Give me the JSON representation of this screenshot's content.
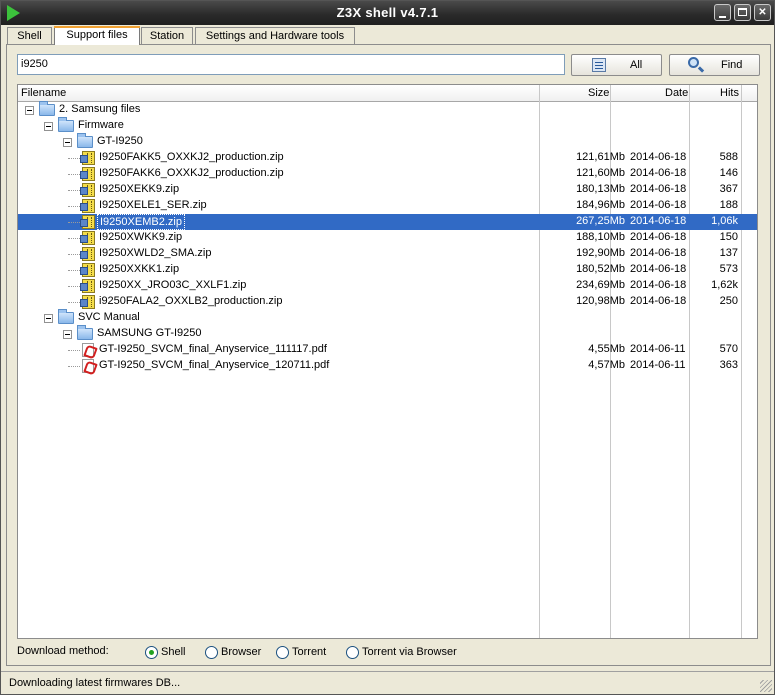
{
  "window": {
    "title": "Z3X shell v4.7.1"
  },
  "tabs": [
    {
      "label": "Shell",
      "active": false
    },
    {
      "label": "Support files",
      "active": true
    },
    {
      "label": "Station",
      "active": false
    },
    {
      "label": "Settings and Hardware tools",
      "active": false
    }
  ],
  "search": {
    "value": "i9250"
  },
  "buttons": {
    "all": "All",
    "find": "Find"
  },
  "columns": {
    "filename": "Filename",
    "size": "Size",
    "date": "Date",
    "hits": "Hits"
  },
  "tree": [
    {
      "type": "folder",
      "level": 0,
      "name": "2. Samsung files",
      "size": "",
      "date": "",
      "hits": "",
      "selected": false
    },
    {
      "type": "folder",
      "level": 1,
      "name": "Firmware",
      "size": "",
      "date": "",
      "hits": "",
      "selected": false
    },
    {
      "type": "folder",
      "level": 2,
      "name": "GT-I9250",
      "size": "",
      "date": "",
      "hits": "",
      "selected": false
    },
    {
      "type": "zip",
      "level": 3,
      "name": "I9250FAKK5_OXXKJ2_production.zip",
      "size": "121,61Mb",
      "date": "2014-06-18",
      "hits": "588",
      "selected": false
    },
    {
      "type": "zip",
      "level": 3,
      "name": "I9250FAKK6_OXXKJ2_production.zip",
      "size": "121,60Mb",
      "date": "2014-06-18",
      "hits": "146",
      "selected": false
    },
    {
      "type": "zip",
      "level": 3,
      "name": "I9250XEKK9.zip",
      "size": "180,13Mb",
      "date": "2014-06-18",
      "hits": "367",
      "selected": false
    },
    {
      "type": "zip",
      "level": 3,
      "name": "I9250XELE1_SER.zip",
      "size": "184,96Mb",
      "date": "2014-06-18",
      "hits": "188",
      "selected": false
    },
    {
      "type": "zip",
      "level": 3,
      "name": "I9250XEMB2.zip",
      "size": "267,25Mb",
      "date": "2014-06-18",
      "hits": "1,06k",
      "selected": true
    },
    {
      "type": "zip",
      "level": 3,
      "name": "I9250XWKK9.zip",
      "size": "188,10Mb",
      "date": "2014-06-18",
      "hits": "150",
      "selected": false
    },
    {
      "type": "zip",
      "level": 3,
      "name": "I9250XWLD2_SMA.zip",
      "size": "192,90Mb",
      "date": "2014-06-18",
      "hits": "137",
      "selected": false
    },
    {
      "type": "zip",
      "level": 3,
      "name": "I9250XXKK1.zip",
      "size": "180,52Mb",
      "date": "2014-06-18",
      "hits": "573",
      "selected": false
    },
    {
      "type": "zip",
      "level": 3,
      "name": "I9250XX_JRO03C_XXLF1.zip",
      "size": "234,69Mb",
      "date": "2014-06-18",
      "hits": "1,62k",
      "selected": false
    },
    {
      "type": "zip",
      "level": 3,
      "name": "i9250FALA2_OXXLB2_production.zip",
      "size": "120,98Mb",
      "date": "2014-06-18",
      "hits": "250",
      "selected": false
    },
    {
      "type": "folder",
      "level": 1,
      "name": "SVC Manual",
      "size": "",
      "date": "",
      "hits": "",
      "selected": false
    },
    {
      "type": "folder",
      "level": 2,
      "name": "SAMSUNG GT-I9250",
      "size": "",
      "date": "",
      "hits": "",
      "selected": false
    },
    {
      "type": "pdf",
      "level": 3,
      "name": "GT-I9250_SVCM_final_Anyservice_111117.pdf",
      "size": "4,55Mb",
      "date": "2014-06-11",
      "hits": "570",
      "selected": false
    },
    {
      "type": "pdf",
      "level": 3,
      "name": "GT-I9250_SVCM_final_Anyservice_120711.pdf",
      "size": "4,57Mb",
      "date": "2014-06-11",
      "hits": "363",
      "selected": false
    }
  ],
  "download": {
    "label": "Download method:",
    "options": [
      {
        "label": "Shell",
        "checked": true
      },
      {
        "label": "Browser",
        "checked": false
      },
      {
        "label": "Torrent",
        "checked": false
      },
      {
        "label": "Torrent via Browser",
        "checked": false
      }
    ]
  },
  "status": {
    "text": "Downloading latest firmwares DB..."
  },
  "colors": {
    "selection": "#316ac5",
    "titlebar": "#2b2b2b",
    "tab_accent": "#f0a030"
  }
}
